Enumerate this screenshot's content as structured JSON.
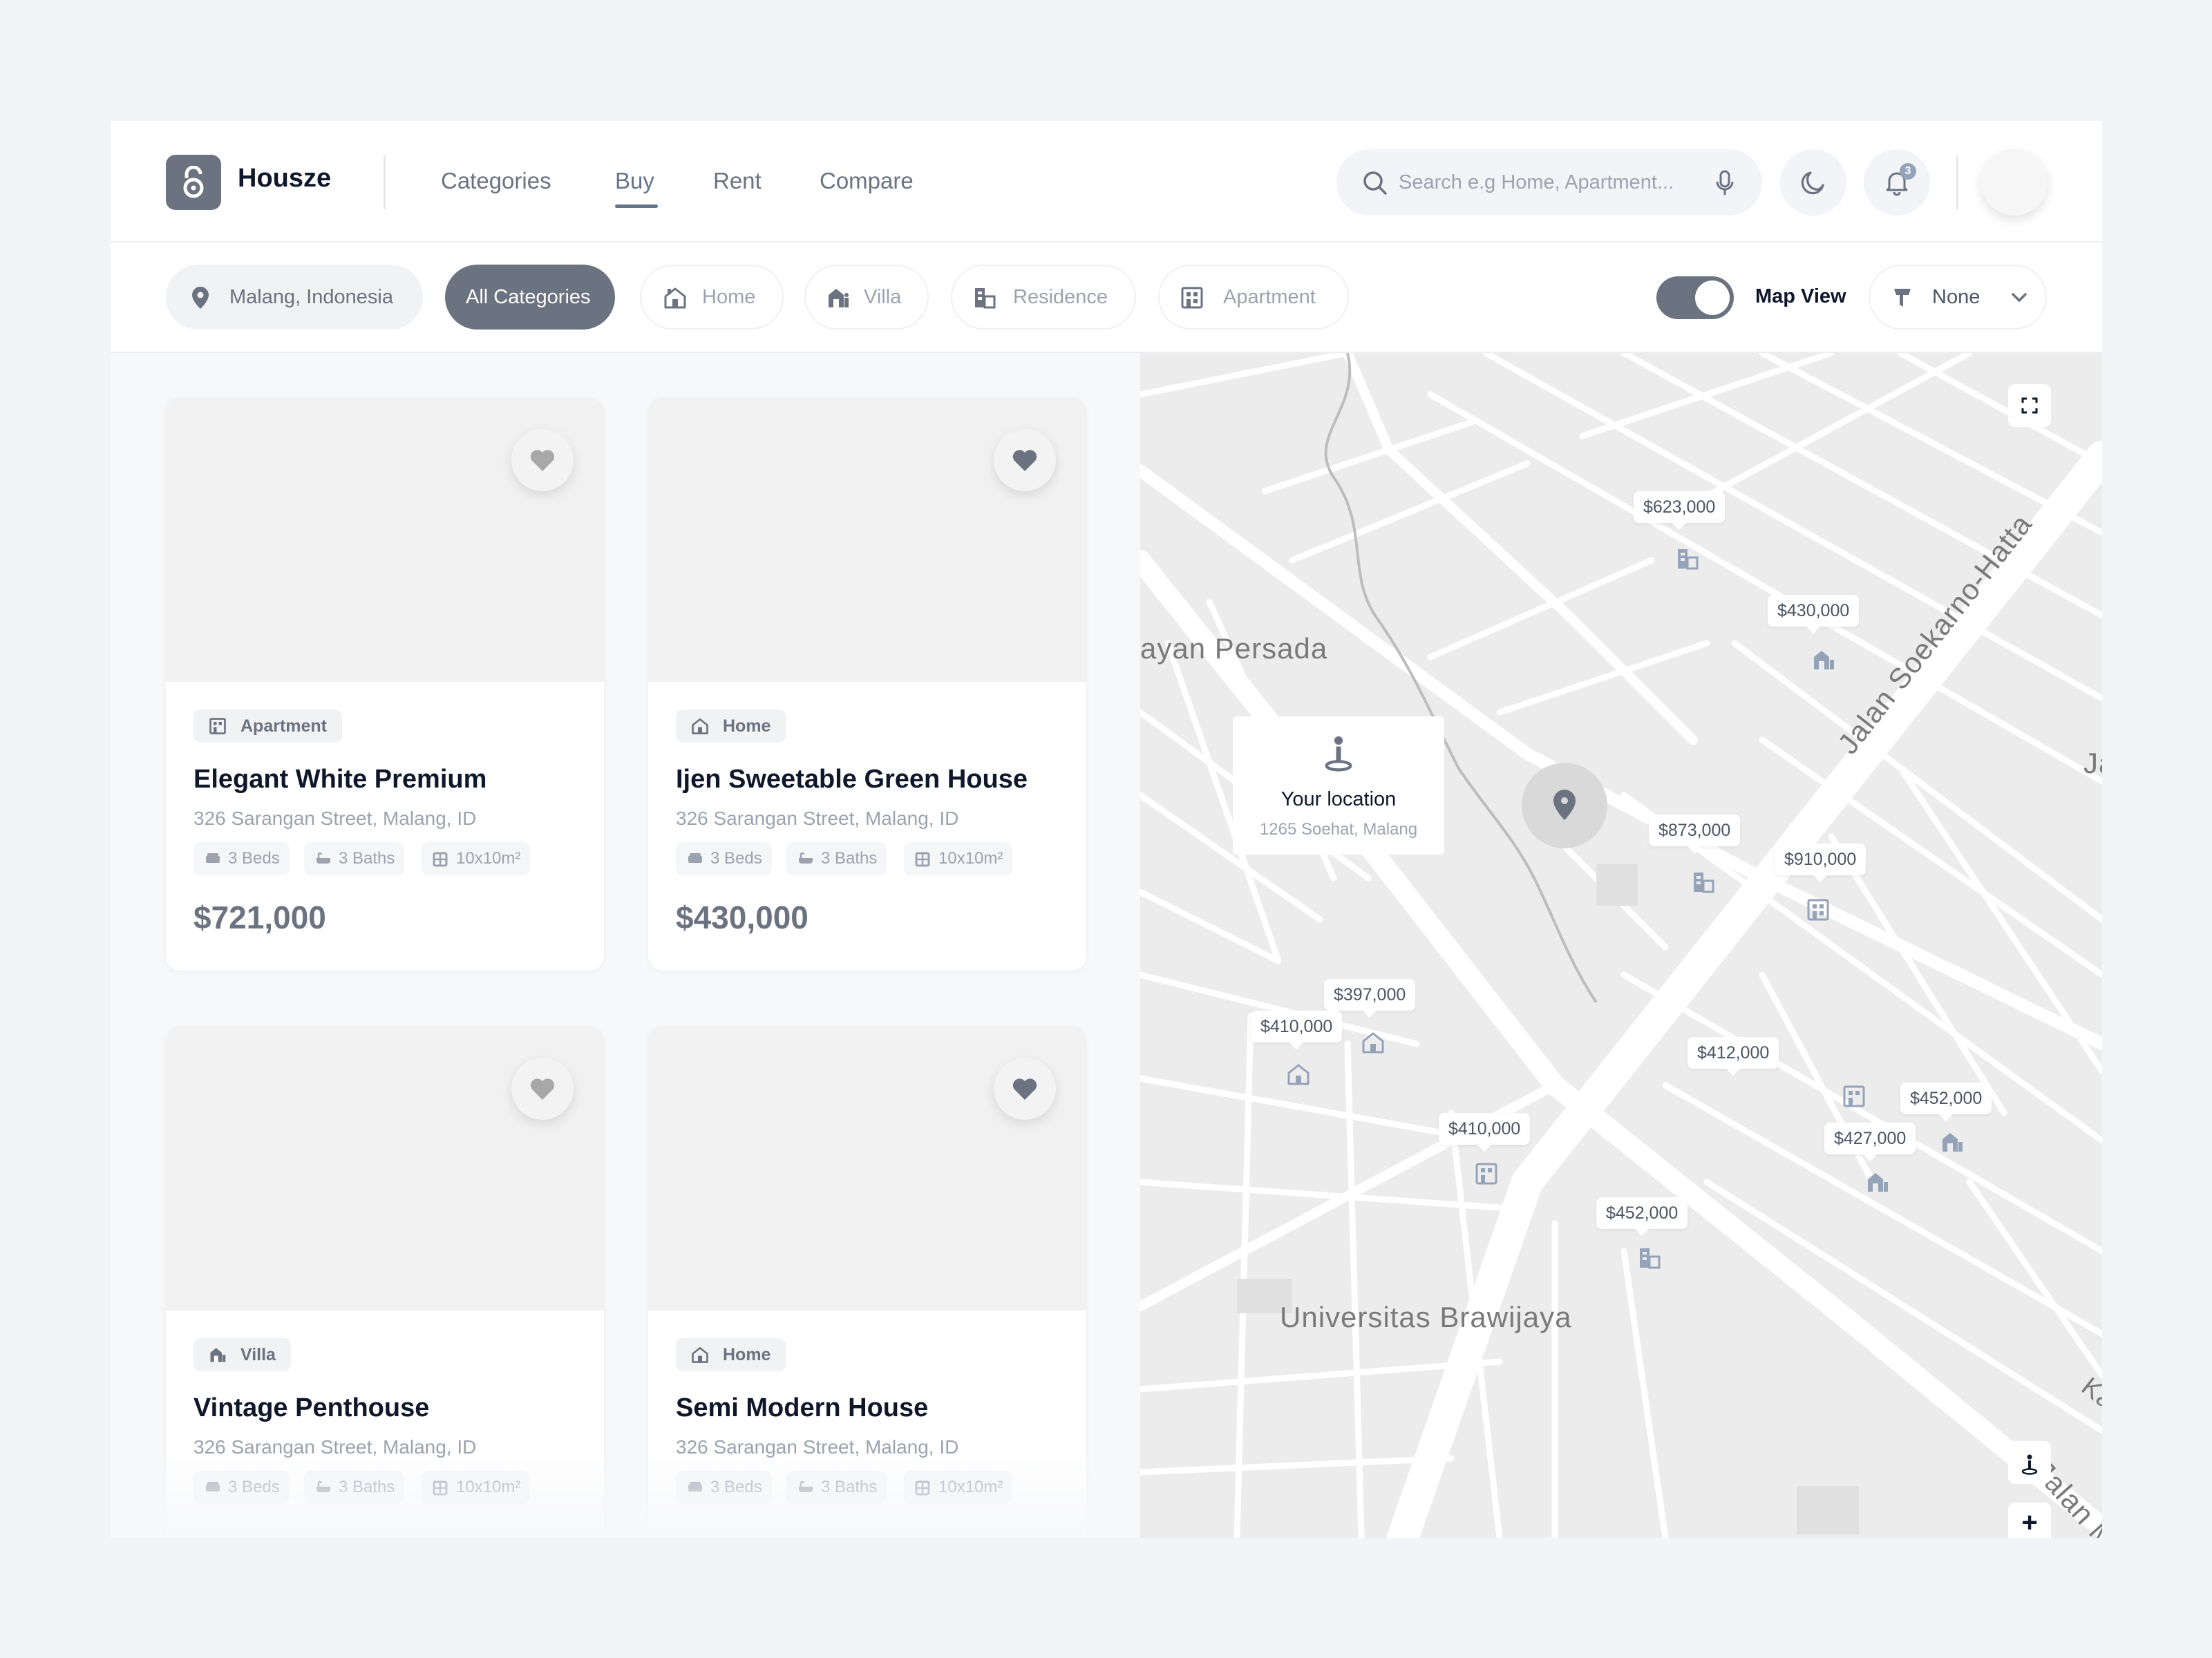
{
  "brand": "Housze",
  "nav": {
    "categories": "Categories",
    "buy": "Buy",
    "rent": "Rent",
    "compare": "Compare",
    "active": "Buy"
  },
  "search": {
    "placeholder": "Search e.g Home, Apartment..."
  },
  "notifications": {
    "count": "3"
  },
  "filters": {
    "location": "Malang, Indonesia",
    "all": "All Categories",
    "home": "Home",
    "villa": "Villa",
    "residence": "Residence",
    "apartment": "Apartment",
    "map_view_label": "Map View",
    "map_view_on": true,
    "sort_value": "None"
  },
  "listings": [
    {
      "category": "Apartment",
      "title": "Elegant White Premium",
      "address": "326 Sarangan Street, Malang, ID",
      "beds": "3 Beds",
      "baths": "3 Baths",
      "area": "10x10m²",
      "price": "$721,000"
    },
    {
      "category": "Home",
      "title": "Ijen Sweetable Green House",
      "address": "326 Sarangan Street, Malang, ID",
      "beds": "3 Beds",
      "baths": "3 Baths",
      "area": "10x10m²",
      "price": "$430,000"
    },
    {
      "category": "Villa",
      "title": "Vintage Penthouse",
      "address": "326 Sarangan Street, Malang, ID",
      "beds": "3 Beds",
      "baths": "3 Baths",
      "area": "10x10m²",
      "price": ""
    },
    {
      "category": "Home",
      "title": "Semi Modern House",
      "address": "326 Sarangan Street, Malang, ID",
      "beds": "3 Beds",
      "baths": "3 Baths",
      "area": "10x10m²",
      "price": ""
    }
  ],
  "map": {
    "your_location_title": "Your location",
    "your_location_address": "1265 Soehat, Malang",
    "places": [
      "ayan Persada",
      "Universitas Brawijaya",
      "Jalan Soekarno-Hatta",
      "Jalan M",
      "Kalimantas",
      "Ja"
    ],
    "price_pins": [
      "$623,000",
      "$430,000",
      "$873,000",
      "$910,000",
      "$397,000",
      "$410,000",
      "$412,000",
      "$452,000",
      "$427,000",
      "$410,000",
      "$452,000"
    ]
  },
  "colors": {
    "accent": "#6b7280",
    "text": "#0f172a",
    "muted": "#9ca3af"
  }
}
